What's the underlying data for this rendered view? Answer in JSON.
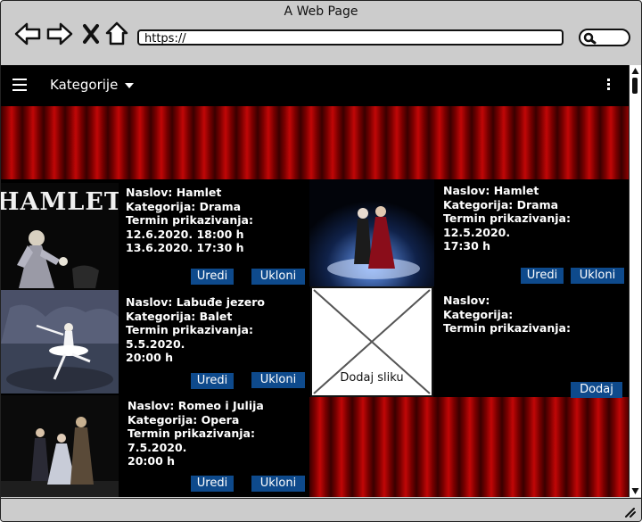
{
  "browser": {
    "window_title": "A Web Page",
    "url": "https://",
    "icons": [
      "back-icon",
      "forward-icon",
      "close-icon",
      "home-icon",
      "search-icon"
    ]
  },
  "appbar": {
    "menu_label": "Kategorije"
  },
  "shows": [
    {
      "title_label": "Naslov: Hamlet",
      "category_label": "Kategorija: Drama",
      "schedule_label": "Termin prikazivanja:",
      "times": [
        "12.6.2020. 18:00 h",
        "13.6.2020. 17:30 h"
      ],
      "edit_label": "Uredi",
      "remove_label": "Ukloni",
      "poster_text": "HAMLET"
    },
    {
      "title_label": "Naslov: Hamlet",
      "category_label": "Kategorija: Drama",
      "schedule_label": "Termin prikazivanja: 12.5.2020.",
      "times": [
        "17:30 h"
      ],
      "edit_label": "Uredi",
      "remove_label": "Ukloni"
    },
    {
      "title_label": "Naslov: Labuđe jezero",
      "category_label": "Kategorija: Balet",
      "schedule_label": "Termin prikazivanja: 5.5.2020.",
      "times": [
        "20:00 h"
      ],
      "edit_label": "Uredi",
      "remove_label": "Ukloni"
    },
    {
      "title_label": "Naslov: Romeo i Julija",
      "category_label": "Kategorija: Opera",
      "schedule_label": "Termin prikazivanja: 7.5.2020.",
      "times": [
        "20:00 h"
      ],
      "edit_label": "Uredi",
      "remove_label": "Ukloni"
    }
  ],
  "new_show": {
    "image_placeholder_label": "Dodaj sliku",
    "title_label": "Naslov:",
    "category_label": "Kategorija:",
    "schedule_label": "Termin prikazivanja:",
    "add_label": "Dodaj"
  },
  "colors": {
    "button": "#0e4a8c",
    "curtain": "#c10707",
    "background": "#000000"
  }
}
